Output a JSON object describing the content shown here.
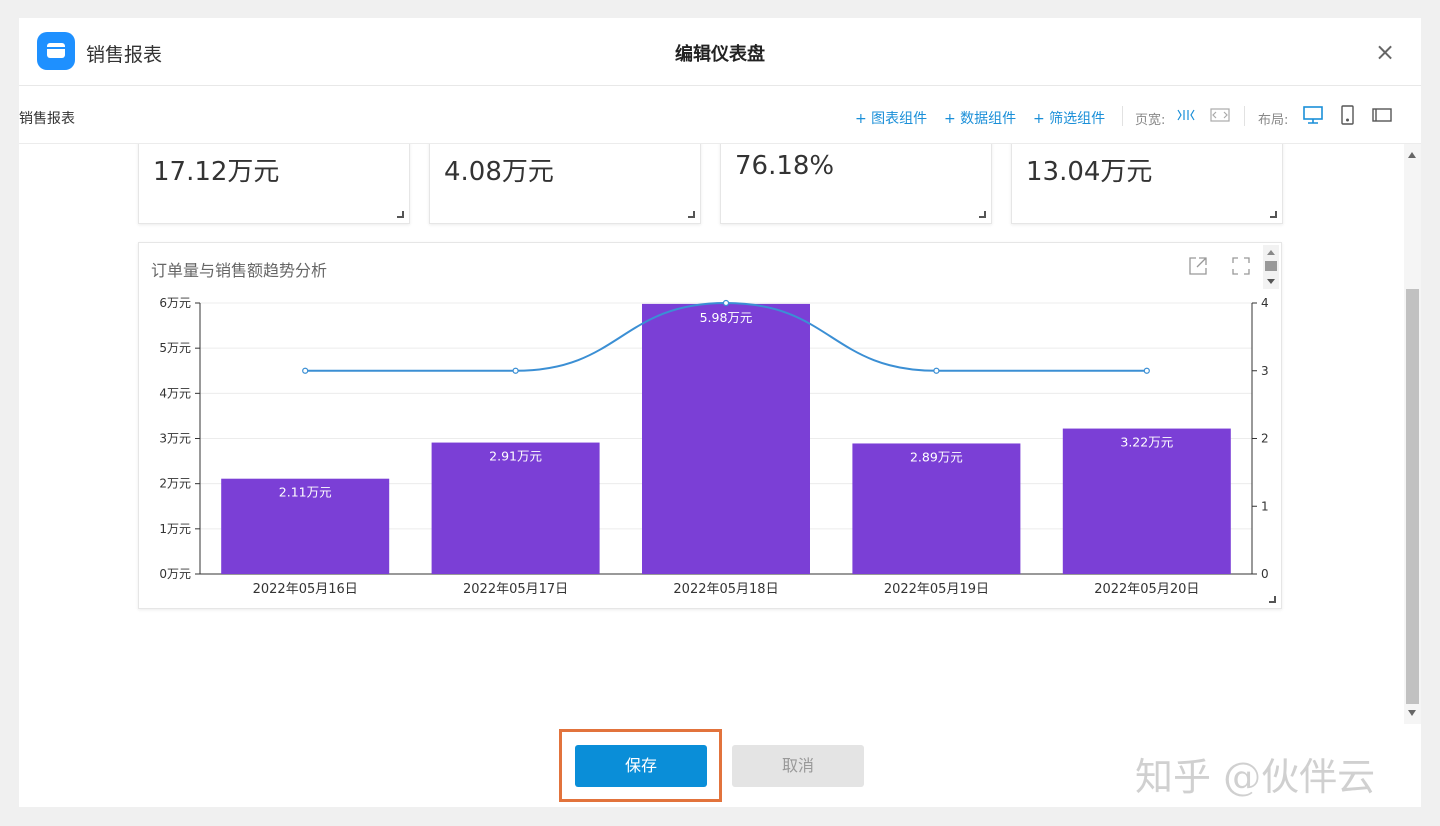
{
  "header": {
    "app_name": "销售报表",
    "title": "编辑仪表盘",
    "close_glyph": "×"
  },
  "toolbar": {
    "breadcrumb": "销售报表",
    "add_chart": "+ 图表组件",
    "add_data": "+ 数据组件",
    "add_filter": "+ 筛选组件",
    "page_width_label": "页宽:",
    "layout_label": "布局:"
  },
  "kpis": [
    {
      "value": "17.12万元"
    },
    {
      "value": "4.08万元"
    },
    {
      "value": "76.18%"
    },
    {
      "value": "13.04万元"
    }
  ],
  "chart_card": {
    "title": "订单量与销售额趋势分析"
  },
  "chart_data": {
    "type": "bar",
    "title": "订单量与销售额趋势分析",
    "categories": [
      "2022年05月16日",
      "2022年05月17日",
      "2022年05月18日",
      "2022年05月19日",
      "2022年05月20日"
    ],
    "series": [
      {
        "values": [
          2.11,
          2.91,
          5.98,
          2.89,
          3.22
        ],
        "labels": [
          "2.11万元",
          "2.91万元",
          "5.98万元",
          "2.89万元",
          "3.22万元"
        ],
        "axis": "left",
        "type": "bar",
        "color": "#7b3fd6"
      },
      {
        "values": [
          3,
          3,
          4,
          3,
          3
        ],
        "axis": "right",
        "type": "line",
        "color": "#3b8fd4"
      }
    ],
    "y_left": {
      "ticks": [
        "0万元",
        "1万元",
        "2万元",
        "3万元",
        "4万元",
        "5万元",
        "6万元"
      ],
      "ylim": [
        0,
        6
      ]
    },
    "y_right": {
      "ticks": [
        "0",
        "1",
        "2",
        "3",
        "4"
      ],
      "ylim": [
        0,
        4
      ]
    },
    "grid": true
  },
  "footer": {
    "save": "保存",
    "cancel": "取消"
  },
  "watermark": "知乎 @伙伴云"
}
